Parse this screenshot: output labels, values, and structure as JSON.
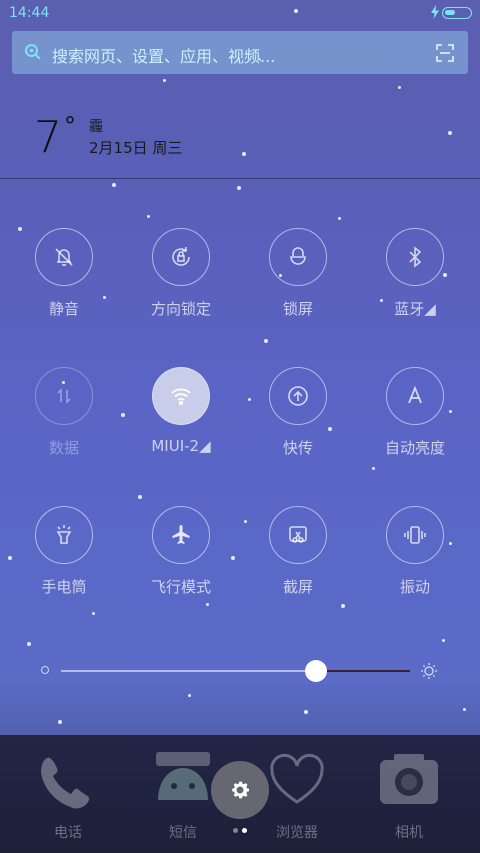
{
  "status_bar": {
    "time": "14:44"
  },
  "search": {
    "placeholder": "搜索网页、设置、应用、视频..."
  },
  "weather": {
    "temperature": "7",
    "degree_symbol": "°",
    "condition": "霾",
    "date": "2月15日 周三"
  },
  "toggles": [
    {
      "label": "静音",
      "icon": "bell-off-icon",
      "active": false
    },
    {
      "label": "方向锁定",
      "icon": "rotation-lock-icon",
      "active": false
    },
    {
      "label": "锁屏",
      "icon": "lock-icon",
      "active": false
    },
    {
      "label": "蓝牙◢",
      "icon": "bluetooth-icon",
      "active": false
    },
    {
      "label": "数据",
      "icon": "mobile-data-icon",
      "active": false
    },
    {
      "label": "MIUI-2◢",
      "icon": "wifi-icon",
      "active": true
    },
    {
      "label": "快传",
      "icon": "share-upload-icon",
      "active": false
    },
    {
      "label": "自动亮度",
      "icon": "auto-brightness-icon",
      "active": false
    },
    {
      "label": "手电筒",
      "icon": "flashlight-icon",
      "active": false
    },
    {
      "label": "飞行模式",
      "icon": "airplane-icon",
      "active": false
    },
    {
      "label": "截屏",
      "icon": "screenshot-icon",
      "active": false
    },
    {
      "label": "振动",
      "icon": "vibrate-icon",
      "active": false
    }
  ],
  "brightness": {
    "level_percent": 73
  },
  "dock": {
    "apps": [
      {
        "label": "电话",
        "icon": "phone-icon"
      },
      {
        "label": "短信",
        "icon": "messages-icon"
      },
      {
        "label": "浏览器",
        "icon": "browser-icon"
      },
      {
        "label": "相机",
        "icon": "camera-icon"
      }
    ],
    "settings_icon": "gear-icon",
    "page_indicator": {
      "pages": 2,
      "current": 2
    }
  },
  "colors": {
    "accent": "#7de3f0",
    "track_right": "#3a2030"
  }
}
